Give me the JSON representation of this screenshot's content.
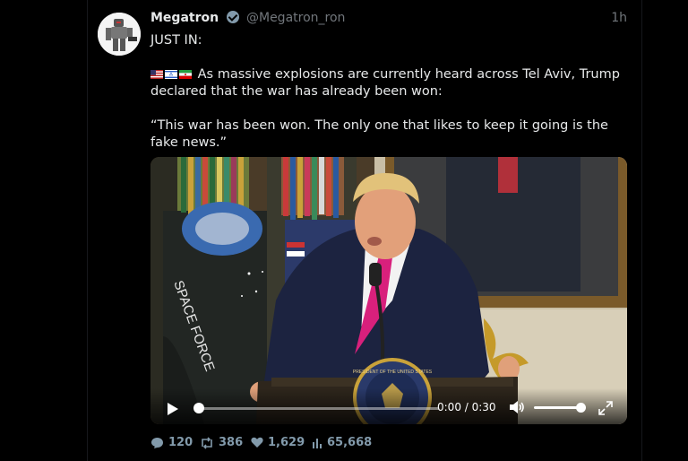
{
  "post": {
    "author_name": "Megatron",
    "handle": "@Megatron_ron",
    "time": "1h",
    "line1": "JUST IN:",
    "line2": "As massive explosions are currently heard across Tel Aviv, Trump declared that the war has already been won:",
    "line3": "“This war has been won. The only one that likes to keep it going is the fake news.”"
  },
  "flags": [
    "us-flag-icon",
    "israel-flag-icon",
    "iran-flag-icon"
  ],
  "video": {
    "time": "0:00 / 0:30",
    "progress": 0,
    "volume": 1.0,
    "podium_text": "PRESIDENT OF THE UNITED STATES",
    "flag_text": "SPACE FORCE"
  },
  "stats": {
    "replies": "120",
    "reposts": "386",
    "likes": "1,629",
    "views": "65,668"
  },
  "colors": {
    "background": "#000000",
    "text": "#e7e9ea",
    "muted": "#71767b",
    "verified": "#829aab"
  }
}
